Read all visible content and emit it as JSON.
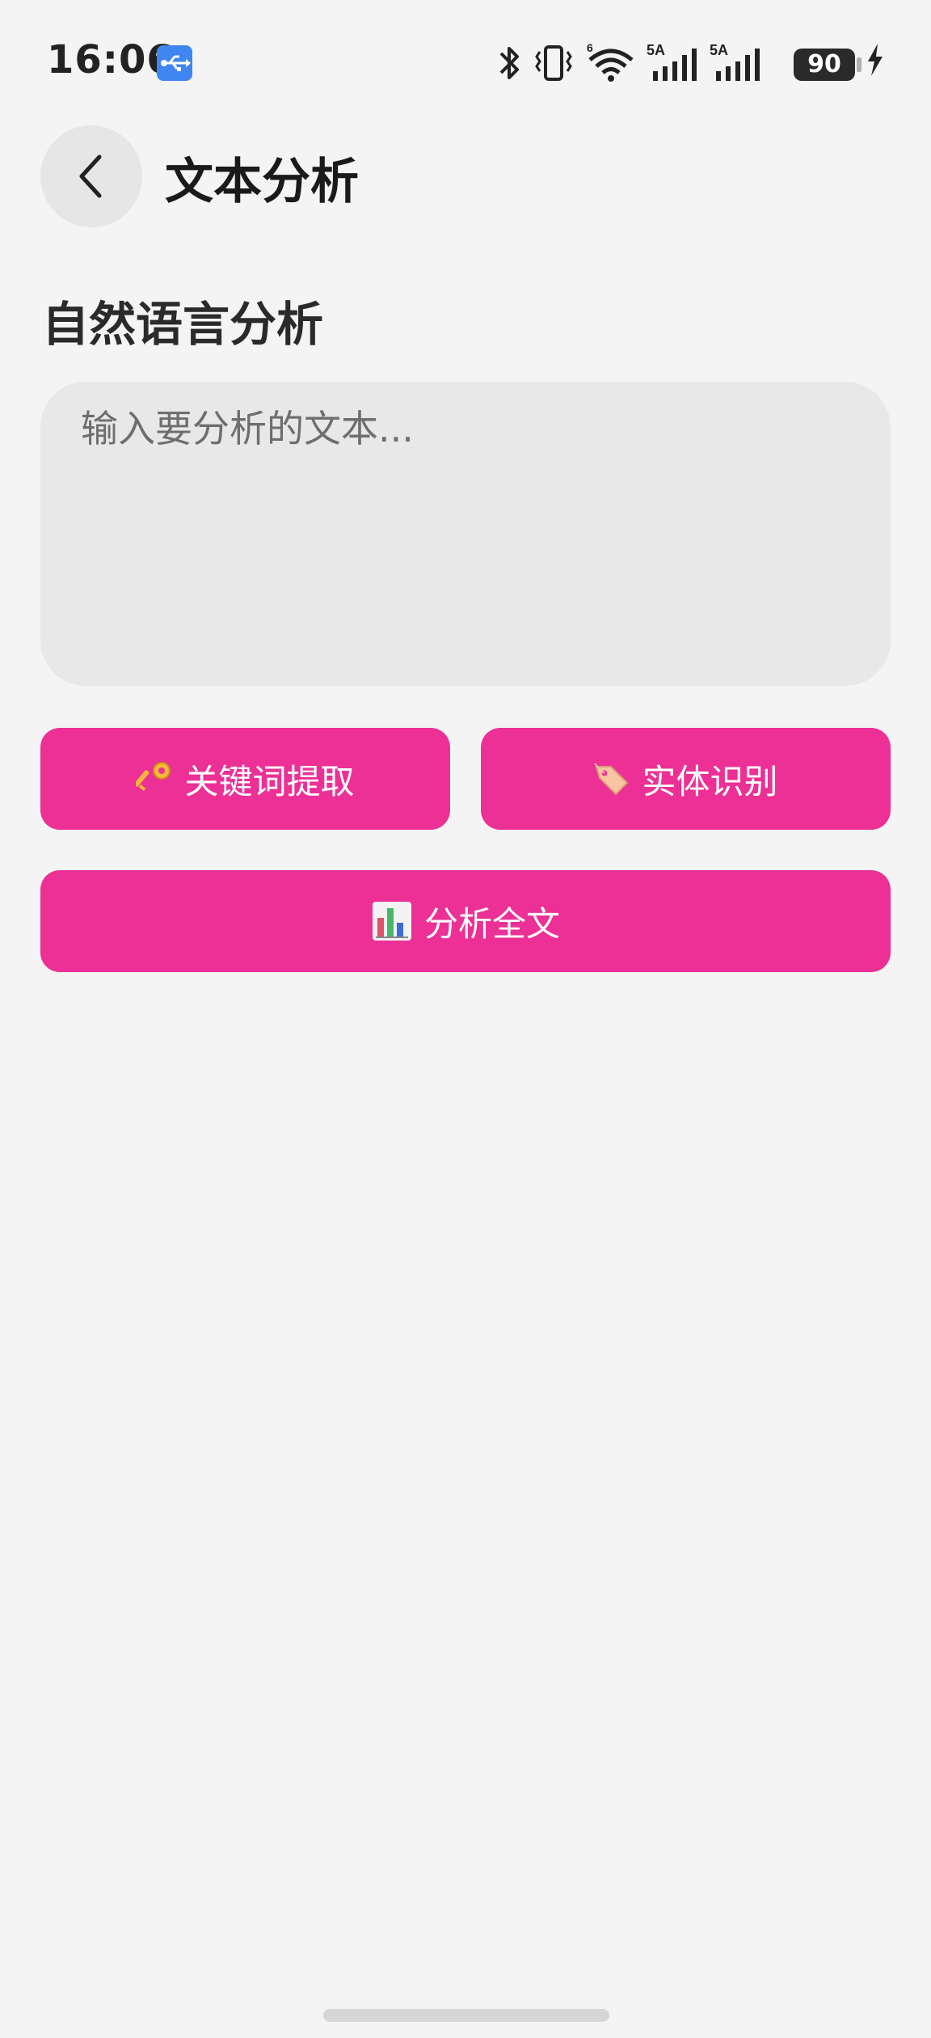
{
  "status_bar": {
    "time": "16:06",
    "battery_level": "90",
    "network_label_1": "5A",
    "network_label_2": "5A",
    "wifi_label": "6",
    "icons": [
      "usb-icon",
      "bluetooth-icon",
      "vibrate-icon",
      "wifi-icon",
      "signal-icon",
      "signal-icon",
      "battery-icon",
      "charging-icon"
    ]
  },
  "header": {
    "title": "文本分析",
    "back_icon": "chevron-left-icon"
  },
  "main": {
    "section_title": "自然语言分析",
    "input": {
      "value": "",
      "placeholder": "输入要分析的文本..."
    },
    "buttons": {
      "keyword": {
        "icon": "key-icon",
        "label": "关键词提取"
      },
      "entity": {
        "icon": "tag-icon",
        "label": "实体识别"
      },
      "analyze": {
        "icon": "bar-chart-icon",
        "label": "分析全文"
      }
    }
  },
  "colors": {
    "accent": "#ec3095",
    "background": "#f4f4f4",
    "input_background": "#e8e8e8",
    "usb_badge": "#3f86f0"
  }
}
